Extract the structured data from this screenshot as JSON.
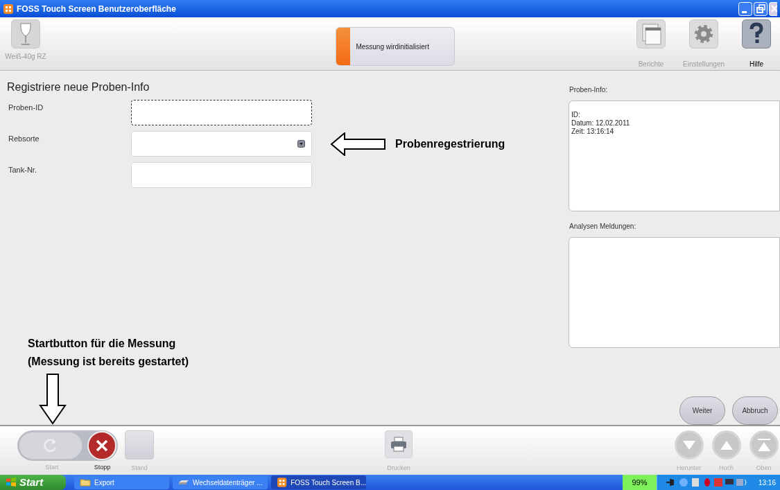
{
  "window": {
    "title": "FOSS Touch Screen Benutzeroberfläche"
  },
  "toolbar": {
    "profile": {
      "label": "Weiß-40g RZ",
      "disabled": true
    },
    "status": {
      "text": "Messung wirdinitialisiert",
      "level": 0.12
    },
    "tools": [
      {
        "kind": "reports",
        "label": "Berichte",
        "disabled": true
      },
      {
        "kind": "settings",
        "label": "Einstellungen",
        "disabled": true
      },
      {
        "kind": "help",
        "label": "Hilfe",
        "disabled": false
      }
    ]
  },
  "form": {
    "heading": "Registriere neue Proben-Info",
    "fields": [
      {
        "label": "Proben-ID",
        "kind": "text",
        "focused": true
      },
      {
        "label": "Rebsorte",
        "kind": "select",
        "focused": false
      },
      {
        "label": "Tank-Nr.",
        "kind": "text",
        "focused": false
      }
    ]
  },
  "annotations": [
    {
      "kind": "left-arrow",
      "text": "Probenregestrierung"
    },
    {
      "kind": "down-arrow",
      "text": "Startbutton für die Messung\n(Messung ist bereits gestartet)"
    }
  ],
  "panels": [
    {
      "label": "Proben-Info:",
      "lines": [
        "ID:",
        "Datum: 12.02.2011",
        "Zeit: 13:16:14"
      ]
    },
    {
      "label": "Analysen Meldungen:"
    }
  ],
  "dialog_buttons": [
    "Weiter",
    "Abbruch"
  ],
  "bottom_bar": {
    "running": true,
    "left": [
      {
        "kind": "start",
        "label": "Start",
        "disabled": true
      },
      {
        "kind": "stop",
        "label": "Stopp",
        "disabled": false
      },
      {
        "kind": "stand",
        "label": "Stand",
        "disabled": true
      }
    ],
    "center": {
      "kind": "print",
      "label": "Drucken",
      "disabled": true
    },
    "right": [
      {
        "kind": "down",
        "label": "Herunter",
        "disabled": true
      },
      {
        "kind": "up",
        "label": "Hoch",
        "disabled": true
      },
      {
        "kind": "top",
        "label": "Oben",
        "disabled": true
      }
    ]
  },
  "taskbar": {
    "start": "Start",
    "items": [
      {
        "kind": "folder",
        "label": "Export",
        "selected": false
      },
      {
        "kind": "drive",
        "label": "Wechseldatenträger ...",
        "selected": false
      },
      {
        "kind": "app",
        "label": "FOSS Touch Screen B...",
        "selected": true
      }
    ],
    "battery": "99%",
    "clock": "13:16"
  }
}
